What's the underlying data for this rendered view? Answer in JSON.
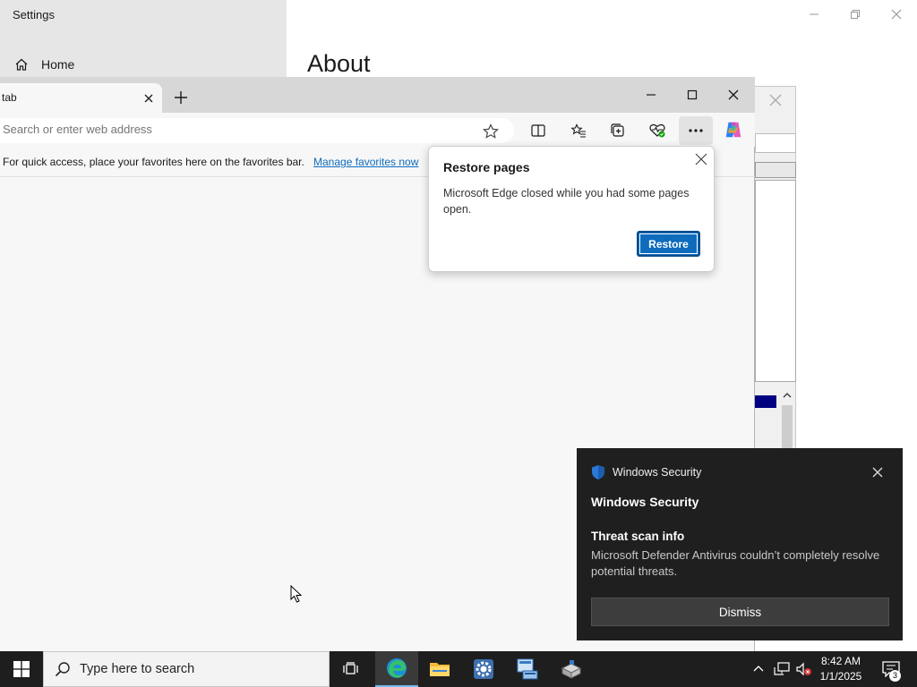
{
  "settings": {
    "title": "Settings",
    "home_label": "Home",
    "page_heading": "About"
  },
  "edge": {
    "tab_title": "tab",
    "address_placeholder": "Search or enter web address",
    "favorites_bar_text": "For quick access, place your favorites here on the favorites bar.",
    "favorites_link": "Manage favorites now"
  },
  "restore_popup": {
    "title": "Restore pages",
    "body": "Microsoft Edge closed while you had some pages open.",
    "button": "Restore"
  },
  "toast": {
    "app_name": "Windows Security",
    "heading": "Windows Security",
    "subheading": "Threat scan info",
    "body": "Microsoft Defender Antivirus couldn’t completely resolve potential threats.",
    "dismiss": "Dismiss"
  },
  "taskbar": {
    "search_placeholder": "Type here to search",
    "time": "8:42 AM",
    "date": "1/1/2025",
    "notification_count": "3"
  },
  "colors": {
    "accent": "#0f6cbd",
    "toast_bg": "#1f1f1f",
    "taskbar_bg": "#1e1e1e"
  }
}
